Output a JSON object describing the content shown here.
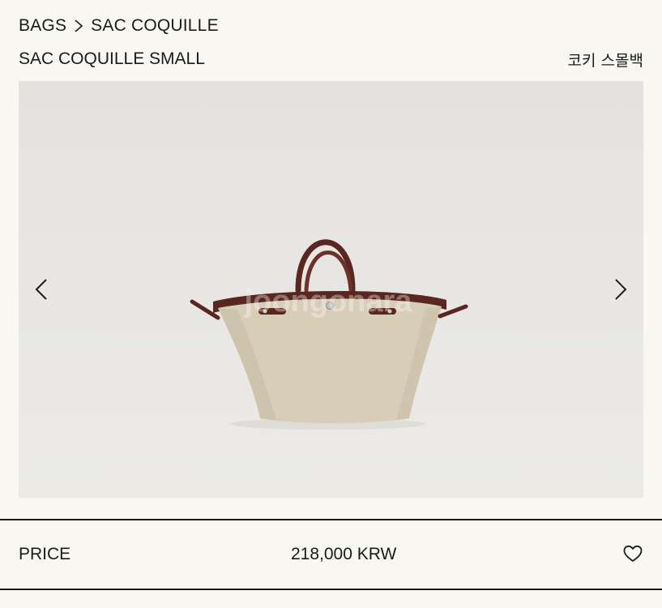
{
  "breadcrumb": {
    "category": "BAGS",
    "product_line": "SAC COQUILLE",
    "separator_icon": "chevron-right-icon"
  },
  "product": {
    "name": "SAC COQUILLE SMALL",
    "color_size_label": "코키 스몰백"
  },
  "gallery": {
    "prev_icon": "chevron-left-icon",
    "next_icon": "chevron-right-icon",
    "watermark": "joongonara",
    "bag_colors": {
      "canvas": "#d8cdb7",
      "leather": "#5a2620",
      "background": "#e6e5e1"
    }
  },
  "price": {
    "label": "PRICE",
    "value": "218,000 KRW",
    "wishlist_icon": "heart-icon"
  }
}
